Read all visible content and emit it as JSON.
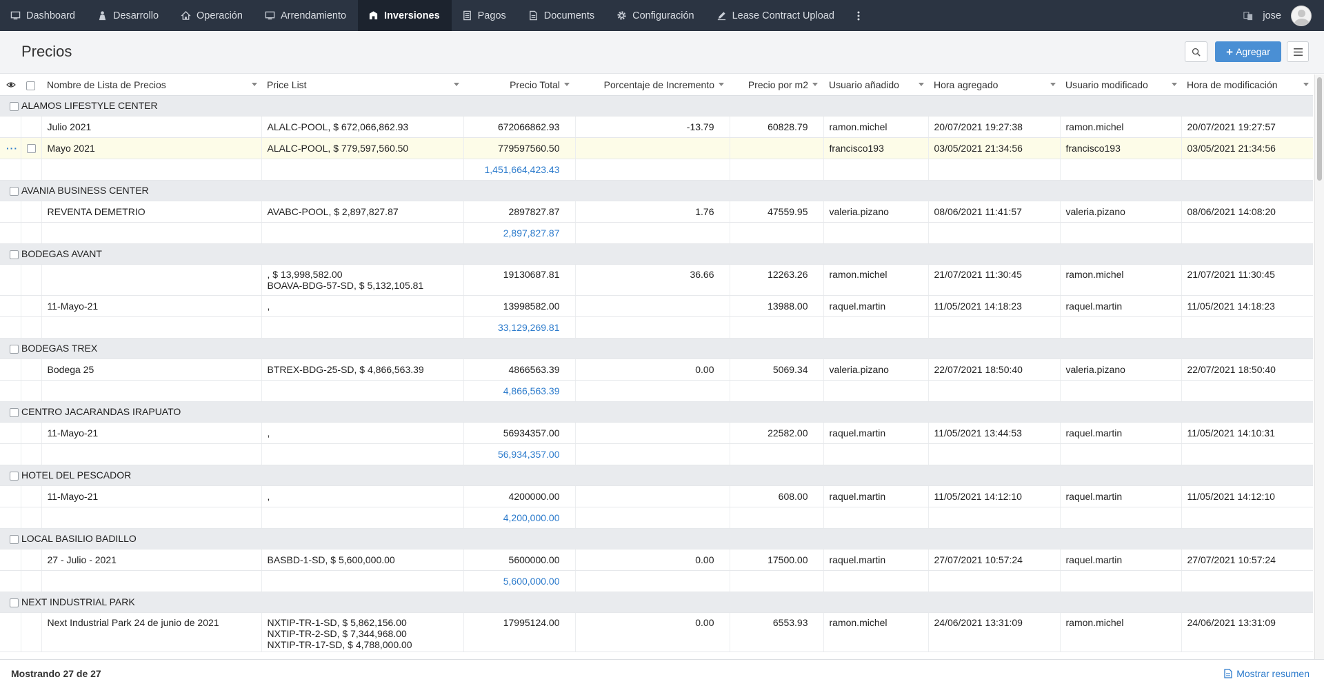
{
  "nav": {
    "items": [
      {
        "label": "Dashboard",
        "icon": "dashboard-icon"
      },
      {
        "label": "Desarrollo",
        "icon": "development-icon"
      },
      {
        "label": "Operación",
        "icon": "operation-icon"
      },
      {
        "label": "Arrendamiento",
        "icon": "monitor-icon"
      },
      {
        "label": "Inversiones",
        "icon": "investment-icon"
      },
      {
        "label": "Pagos",
        "icon": "payments-icon"
      },
      {
        "label": "Documents",
        "icon": "documents-icon"
      },
      {
        "label": "Configuración",
        "icon": "gear-icon"
      },
      {
        "label": "Lease Contract Upload",
        "icon": "pen-icon"
      }
    ],
    "active": "Inversiones",
    "user": "jose"
  },
  "page": {
    "title": "Precios",
    "add_label": "Agregar"
  },
  "table": {
    "headers": [
      "Nombre de Lista de Precios",
      "Price List",
      "Precio Total",
      "Porcentaje de Incremento",
      "Precio por m2",
      "Usuario añadido",
      "Hora agregado",
      "Usuario modificado",
      "Hora de modificación"
    ],
    "groups": [
      {
        "name": "ALAMOS LIFESTYLE CENTER",
        "rows": [
          {
            "name": "Julio 2021",
            "price_list": [
              "ALALC-POOL, $ 672,066,862.93"
            ],
            "total": "672066862.93",
            "increment": "-13.79",
            "per_m2": "60828.79",
            "user_added": "ramon.michel",
            "time_added": "20/07/2021 19:27:38",
            "user_mod": "ramon.michel",
            "time_mod": "20/07/2021 19:27:57"
          },
          {
            "name": "Mayo 2021",
            "price_list": [
              "ALALC-POOL, $ 779,597,560.50"
            ],
            "total": "779597560.50",
            "increment": "",
            "per_m2": "",
            "user_added": "francisco193",
            "time_added": "03/05/2021 21:34:56",
            "user_mod": "francisco193",
            "time_mod": "03/05/2021 21:34:56"
          }
        ],
        "sum": "1,451,664,423.43"
      },
      {
        "name": "AVANIA BUSINESS CENTER",
        "rows": [
          {
            "name": "REVENTA DEMETRIO",
            "price_list": [
              "AVABC-POOL, $ 2,897,827.87"
            ],
            "total": "2897827.87",
            "increment": "1.76",
            "per_m2": "47559.95",
            "user_added": "valeria.pizano",
            "time_added": "08/06/2021 11:41:57",
            "user_mod": "valeria.pizano",
            "time_mod": "08/06/2021 14:08:20"
          }
        ],
        "sum": "2,897,827.87"
      },
      {
        "name": "BODEGAS AVANT",
        "rows": [
          {
            "name": "",
            "price_list": [
              ", $ 13,998,582.00",
              "BOAVA-BDG-57-SD, $ 5,132,105.81"
            ],
            "total": "19130687.81",
            "increment": "36.66",
            "per_m2": "12263.26",
            "user_added": "ramon.michel",
            "time_added": "21/07/2021 11:30:45",
            "user_mod": "ramon.michel",
            "time_mod": "21/07/2021 11:30:45"
          },
          {
            "name": "11-Mayo-21",
            "price_list": [
              ","
            ],
            "total": "13998582.00",
            "increment": "",
            "per_m2": "13988.00",
            "user_added": "raquel.martin",
            "time_added": "11/05/2021 14:18:23",
            "user_mod": "raquel.martin",
            "time_mod": "11/05/2021 14:18:23"
          }
        ],
        "sum": "33,129,269.81"
      },
      {
        "name": "BODEGAS TREX",
        "rows": [
          {
            "name": "Bodega 25",
            "price_list": [
              "BTREX-BDG-25-SD, $ 4,866,563.39"
            ],
            "total": "4866563.39",
            "increment": "0.00",
            "per_m2": "5069.34",
            "user_added": "valeria.pizano",
            "time_added": "22/07/2021 18:50:40",
            "user_mod": "valeria.pizano",
            "time_mod": "22/07/2021 18:50:40"
          }
        ],
        "sum": "4,866,563.39"
      },
      {
        "name": "CENTRO JACARANDAS IRAPUATO",
        "rows": [
          {
            "name": "11-Mayo-21",
            "price_list": [
              ","
            ],
            "total": "56934357.00",
            "increment": "",
            "per_m2": "22582.00",
            "user_added": "raquel.martin",
            "time_added": "11/05/2021 13:44:53",
            "user_mod": "raquel.martin",
            "time_mod": "11/05/2021 14:10:31"
          }
        ],
        "sum": "56,934,357.00"
      },
      {
        "name": "HOTEL DEL PESCADOR",
        "rows": [
          {
            "name": "11-Mayo-21",
            "price_list": [
              ","
            ],
            "total": "4200000.00",
            "increment": "",
            "per_m2": "608.00",
            "user_added": "raquel.martin",
            "time_added": "11/05/2021 14:12:10",
            "user_mod": "raquel.martin",
            "time_mod": "11/05/2021 14:12:10"
          }
        ],
        "sum": "4,200,000.00"
      },
      {
        "name": "LOCAL BASILIO BADILLO",
        "rows": [
          {
            "name": "27 - Julio - 2021",
            "price_list": [
              "BASBD-1-SD, $ 5,600,000.00"
            ],
            "total": "5600000.00",
            "increment": "0.00",
            "per_m2": "17500.00",
            "user_added": "raquel.martin",
            "time_added": "27/07/2021 10:57:24",
            "user_mod": "raquel.martin",
            "time_mod": "27/07/2021 10:57:24"
          }
        ],
        "sum": "5,600,000.00"
      },
      {
        "name": "NEXT INDUSTRIAL PARK",
        "rows": [
          {
            "name": "Next Industrial Park 24 de junio de 2021",
            "price_list": [
              "NXTIP-TR-1-SD, $ 5,862,156.00",
              "NXTIP-TR-2-SD, $ 7,344,968.00",
              "NXTIP-TR-17-SD, $ 4,788,000.00"
            ],
            "total": "17995124.00",
            "increment": "0.00",
            "per_m2": "6553.93",
            "user_added": "ramon.michel",
            "time_added": "24/06/2021 13:31:09",
            "user_mod": "ramon.michel",
            "time_mod": "24/06/2021 13:31:09"
          }
        ],
        "sum": ""
      }
    ]
  },
  "footer": {
    "count": "Mostrando 27 de 27",
    "summary_label": "Mostrar resumen"
  },
  "colors": {
    "nav_bg": "#2b3442",
    "accent": "#4a8fd4",
    "link": "#2c7bcc",
    "group_bg": "#e9ebee"
  }
}
